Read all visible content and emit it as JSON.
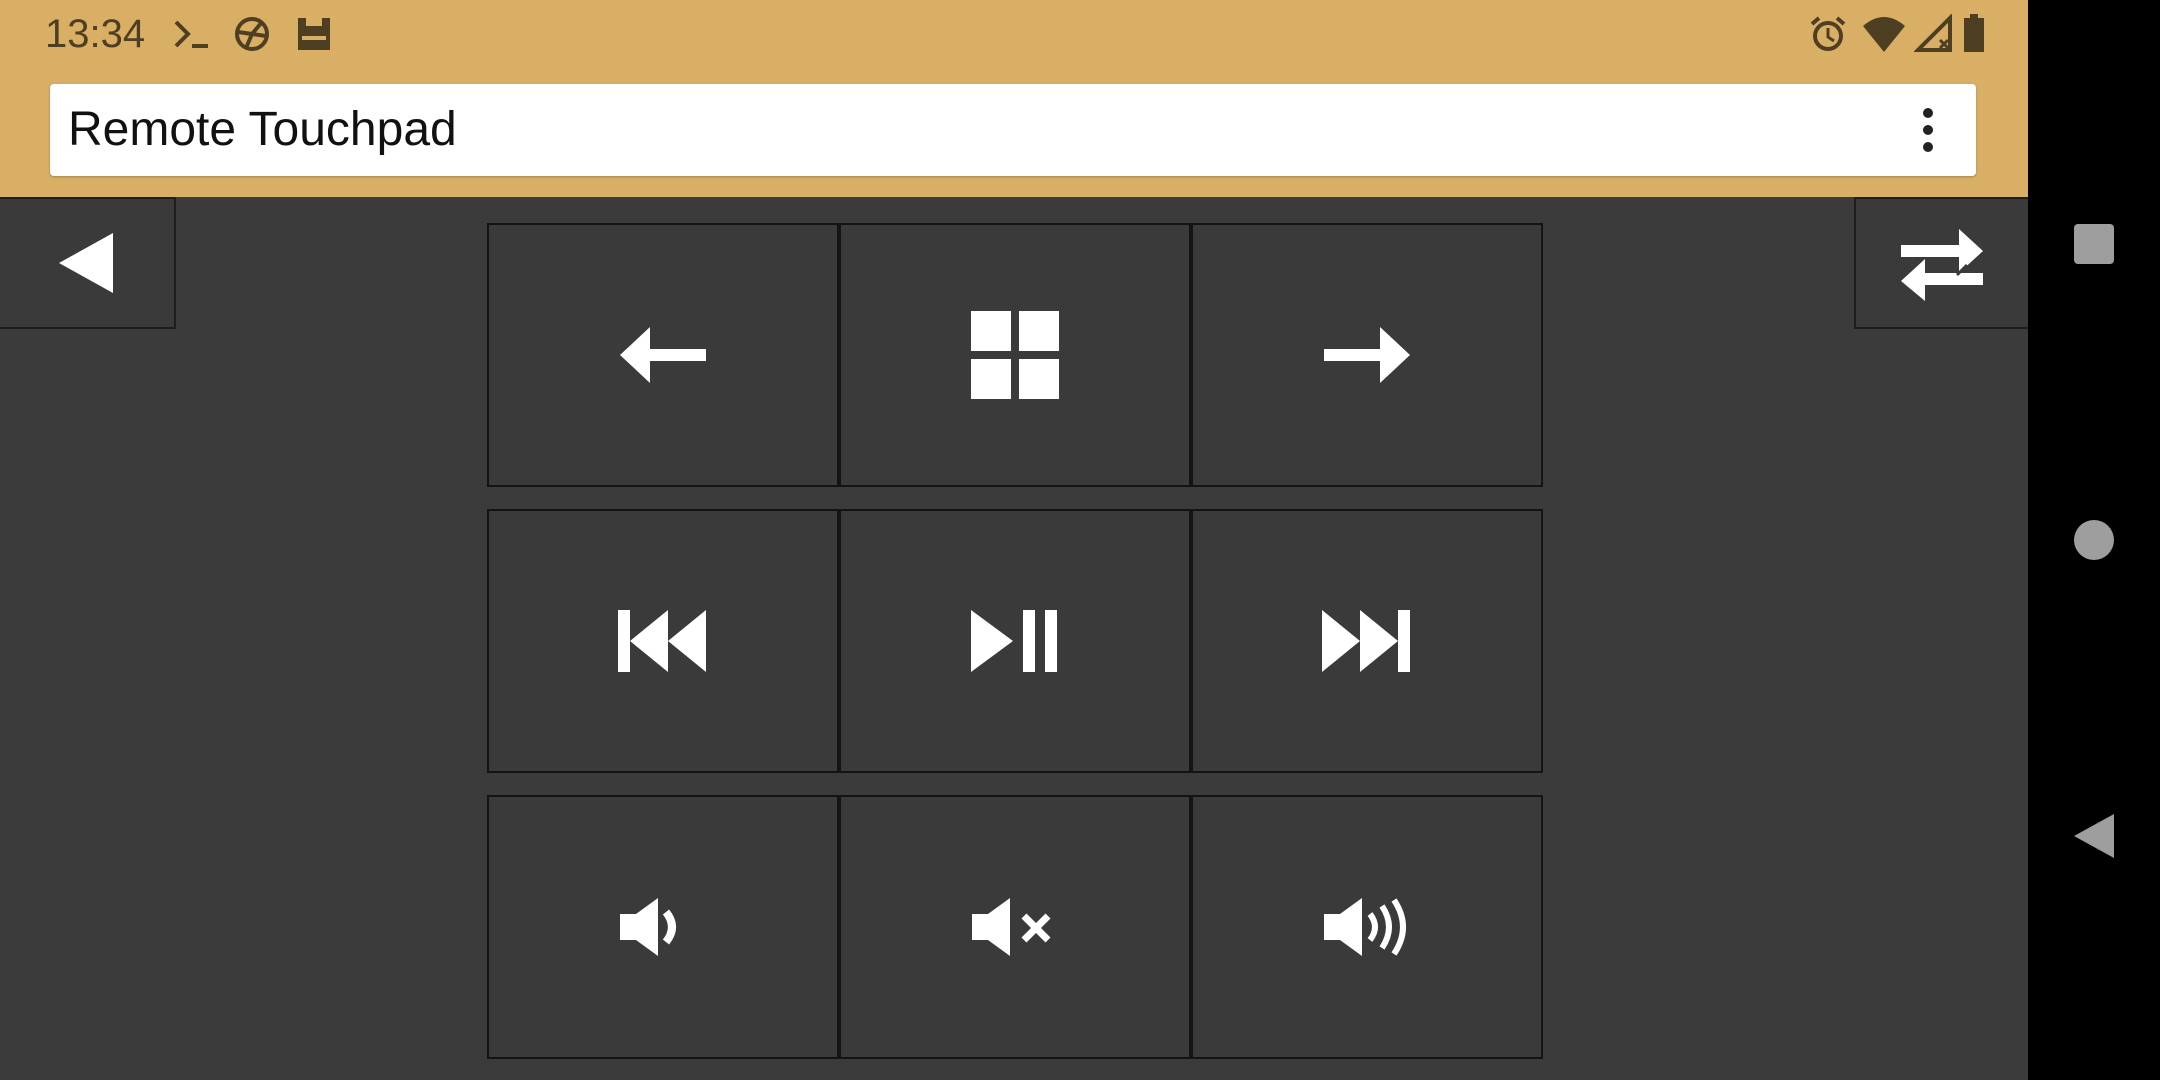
{
  "status_bar": {
    "time": "13:34",
    "left_icons": [
      "terminal-icon",
      "vpn-icon",
      "android-debug-icon"
    ],
    "right_icons": [
      "alarm-icon",
      "wifi-icon",
      "no-signal-icon",
      "battery-icon"
    ]
  },
  "app": {
    "title": "Remote Touchpad",
    "menu_icon": "more-vert-icon"
  },
  "controls": {
    "back_button_icon": "triangle-left-icon",
    "switch_button_icon": "swap-arrows-icon",
    "grid": [
      [
        "arrow-left-icon",
        "windows-icon",
        "arrow-right-icon"
      ],
      [
        "skip-previous-icon",
        "play-pause-icon",
        "skip-next-icon"
      ],
      [
        "volume-down-icon",
        "volume-mute-icon",
        "volume-up-icon"
      ]
    ]
  },
  "navbar": [
    "recents-icon",
    "home-icon",
    "back-icon"
  ],
  "colors": {
    "accent": "#d9af66",
    "background": "#3b3b3b",
    "button_border": "#141414",
    "icon": "#ffffff"
  }
}
